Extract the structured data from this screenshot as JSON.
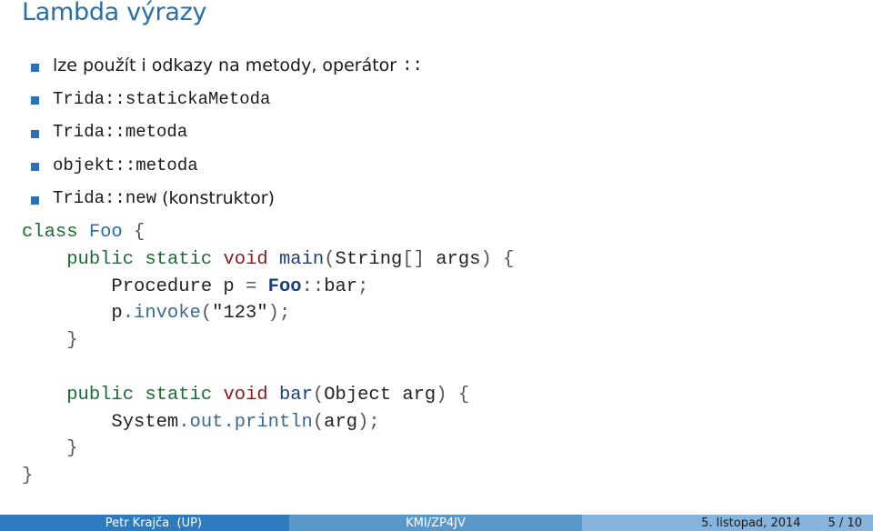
{
  "slide": {
    "title": "Lambda výrazy"
  },
  "bullets": [
    {
      "parts": [
        {
          "style": "sans",
          "text": "lze použít i odkazy na metody, operátor "
        },
        {
          "style": "mono",
          "text": "::"
        }
      ]
    },
    {
      "parts": [
        {
          "style": "mono",
          "text": "Trida::statickaMetoda"
        }
      ]
    },
    {
      "parts": [
        {
          "style": "mono",
          "text": "Trida::metoda"
        }
      ]
    },
    {
      "parts": [
        {
          "style": "mono",
          "text": "objekt::metoda"
        }
      ]
    },
    {
      "parts": [
        {
          "style": "mono",
          "text": "Trida::new"
        },
        {
          "style": "sans",
          "text": " (konstruktor)"
        }
      ]
    }
  ],
  "code": {
    "language": "java",
    "lines": [
      [
        {
          "c": "kw-green",
          "t": "class"
        },
        {
          "c": "",
          "t": " "
        },
        {
          "c": "kw-cls",
          "t": "Foo"
        },
        {
          "c": "punct",
          "t": " {"
        }
      ],
      [
        {
          "c": "",
          "t": "    "
        },
        {
          "c": "kw-green",
          "t": "public"
        },
        {
          "c": "",
          "t": " "
        },
        {
          "c": "kw-green",
          "t": "static"
        },
        {
          "c": "",
          "t": " "
        },
        {
          "c": "kw-red",
          "t": "void"
        },
        {
          "c": "",
          "t": " "
        },
        {
          "c": "kw-blue",
          "t": "main"
        },
        {
          "c": "punct",
          "t": "("
        },
        {
          "c": "",
          "t": "String"
        },
        {
          "c": "punct",
          "t": "[]"
        },
        {
          "c": "",
          "t": " args"
        },
        {
          "c": "punct",
          "t": ") {"
        }
      ],
      [
        {
          "c": "",
          "t": "        Procedure p "
        },
        {
          "c": "punct",
          "t": "="
        },
        {
          "c": "",
          "t": " "
        },
        {
          "c": "kw-bold",
          "t": "Foo"
        },
        {
          "c": "punct",
          "t": "::"
        },
        {
          "c": "",
          "t": "bar"
        },
        {
          "c": "punct",
          "t": ";"
        }
      ],
      [
        {
          "c": "",
          "t": "        p"
        },
        {
          "c": "kw-grey",
          "t": ".invoke"
        },
        {
          "c": "punct",
          "t": "("
        },
        {
          "c": "",
          "t": "\"123\""
        },
        {
          "c": "punct",
          "t": ");"
        }
      ],
      [
        {
          "c": "punct",
          "t": "    }"
        }
      ],
      [
        {
          "c": "",
          "t": ""
        }
      ],
      [
        {
          "c": "",
          "t": "    "
        },
        {
          "c": "kw-green",
          "t": "public"
        },
        {
          "c": "",
          "t": " "
        },
        {
          "c": "kw-green",
          "t": "static"
        },
        {
          "c": "",
          "t": " "
        },
        {
          "c": "kw-red",
          "t": "void"
        },
        {
          "c": "",
          "t": " "
        },
        {
          "c": "kw-blue",
          "t": "bar"
        },
        {
          "c": "punct",
          "t": "("
        },
        {
          "c": "",
          "t": "Object arg"
        },
        {
          "c": "punct",
          "t": ") {"
        }
      ],
      [
        {
          "c": "",
          "t": "        System"
        },
        {
          "c": "kw-grey",
          "t": ".out.println"
        },
        {
          "c": "punct",
          "t": "("
        },
        {
          "c": "",
          "t": "arg"
        },
        {
          "c": "punct",
          "t": ");"
        }
      ],
      [
        {
          "c": "punct",
          "t": "    }"
        }
      ],
      [
        {
          "c": "punct",
          "t": "}"
        }
      ]
    ]
  },
  "footer": {
    "author": "Petr Krajča  (UP)",
    "course": "KMI/ZP4JV",
    "date": "5. listopad, 2014",
    "page": "5 / 10"
  },
  "colors": {
    "title": "#2a6ea6",
    "bullet": "#2a72b5",
    "footer_left": "#2e7bbf",
    "footer_mid": "#5a98cc",
    "footer_right": "#86b4dc"
  }
}
